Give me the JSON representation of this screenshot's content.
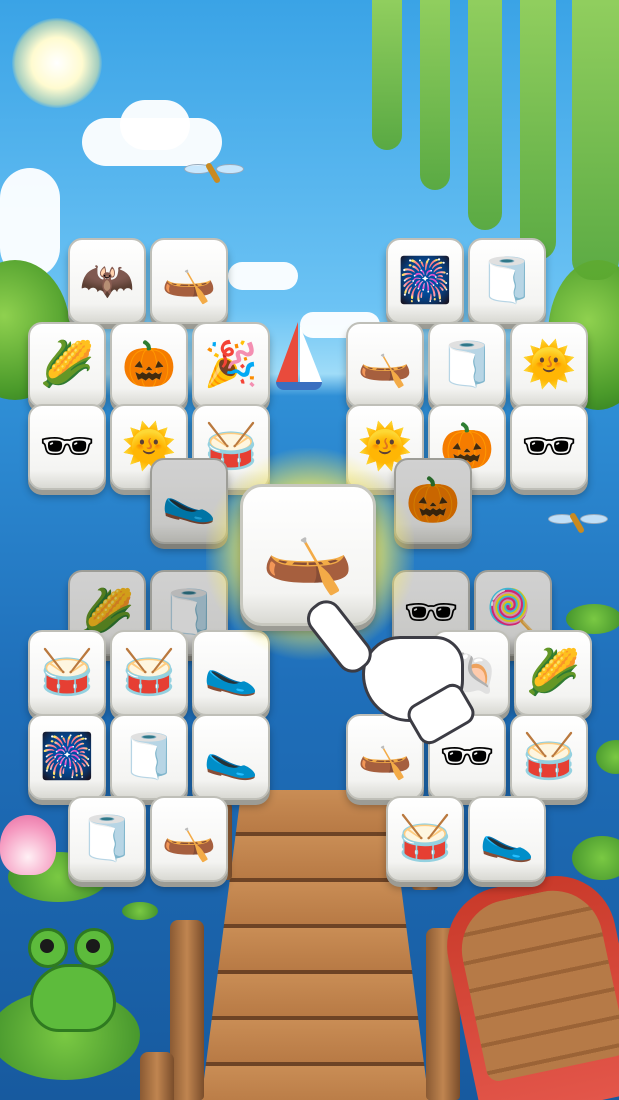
{
  "icons": {
    "bat": "🦇",
    "boat": "🛶",
    "firework": "🎆",
    "towel": "🧻",
    "corn": "🌽",
    "pumpkin": "🎃",
    "party-horn": "🎉",
    "sun": "🌞",
    "sunglasses": "🕶",
    "drum": "🥁",
    "slipper": "🥿",
    "popsicle": "🍭",
    "shell": "🐚",
    "beach-ball": "🏐"
  },
  "board": {
    "left_top": [
      "bat",
      "boat"
    ],
    "left_row2": [
      "corn",
      "pumpkin",
      "party-horn"
    ],
    "left_row3": [
      "sunglasses",
      "sun",
      "drum"
    ],
    "left_row4": [
      "slipper"
    ],
    "right_top": [
      "firework",
      "towel"
    ],
    "right_row2": [
      "boat",
      "towel",
      "sun"
    ],
    "right_row3": [
      "sun",
      "pumpkin",
      "sunglasses"
    ],
    "right_row4": [
      "pumpkin"
    ],
    "left_low1": [
      "corn",
      "towel"
    ],
    "left_low2": [
      "drum",
      "drum",
      "slipper"
    ],
    "left_low3": [
      "firework",
      "towel",
      "slipper"
    ],
    "left_low4": [
      "towel",
      "boat"
    ],
    "right_low1": [
      "sunglasses",
      "popsicle"
    ],
    "right_low2": [
      "shell",
      "corn"
    ],
    "right_low3": [
      "boat",
      "sunglasses",
      "drum"
    ],
    "right_low4": [
      "drum",
      "slipper"
    ],
    "highlighted": "boat"
  },
  "colors": {
    "sky": "#3aa3e6",
    "water": "#1f6fba",
    "highlight_glow": "#fff36a",
    "tile_face": "#ffffff"
  }
}
